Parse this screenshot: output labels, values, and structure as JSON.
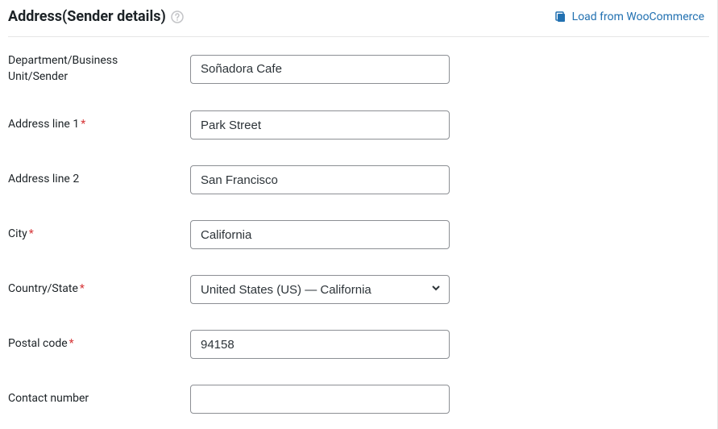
{
  "section": {
    "title": "Address(Sender details)"
  },
  "action": {
    "load_from_woocommerce": "Load from WooCommerce"
  },
  "fields": {
    "department": {
      "label": "Department/Business Unit/Sender",
      "value": "Soñadora Cafe"
    },
    "address1": {
      "label": "Address line 1",
      "value": "Park Street"
    },
    "address2": {
      "label": "Address line 2",
      "value": "San Francisco"
    },
    "city": {
      "label": "City",
      "value": "California"
    },
    "country_state": {
      "label": "Country/State",
      "value": "United States (US) — California"
    },
    "postal_code": {
      "label": "Postal code",
      "value": "94158"
    },
    "contact_number": {
      "label": "Contact number",
      "value": ""
    }
  }
}
